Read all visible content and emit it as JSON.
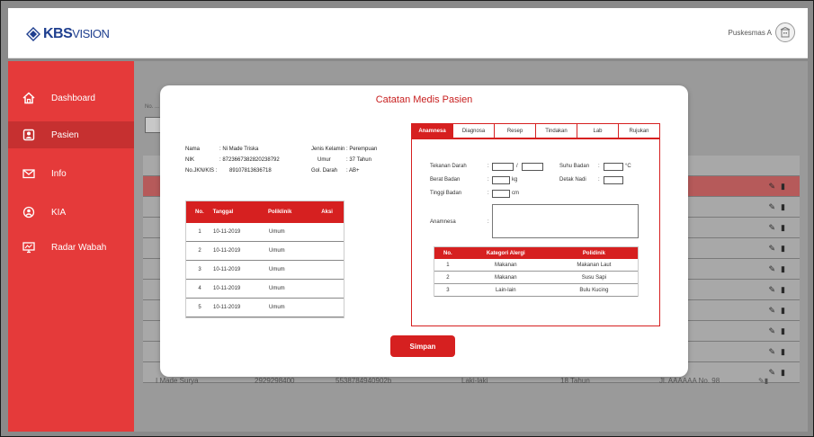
{
  "app": {
    "logo_main": "KBS",
    "logo_sub": "VISION",
    "user_name": "Puskesmas A"
  },
  "sidebar": {
    "items": [
      {
        "label": "Dashboard",
        "icon": "home-icon"
      },
      {
        "label": "Pasien",
        "icon": "patient-icon"
      },
      {
        "label": "Info",
        "icon": "mail-icon"
      },
      {
        "label": "KIA",
        "icon": "baby-icon"
      },
      {
        "label": "Radar Wabah",
        "icon": "monitor-icon"
      }
    ],
    "active_index": 1
  },
  "background": {
    "filter_label": "No. ...",
    "last_row": {
      "name": "I Made Surya",
      "phone": "2929298400",
      "id": "5538784940902b",
      "gender": "Laki-laki",
      "age": "18 Tahun",
      "address": "Jl. AAAAAA No. 98"
    }
  },
  "modal": {
    "title": "Catatan Medis Pasien",
    "patient": {
      "nama_label": "Nama",
      "nama_value": ": Ni Made Triska",
      "nik_label": "NIK",
      "nik_value": ":        8723667382820238792",
      "jkn_label": "No.JKN/KIS  :",
      "jkn_value": "89107813636718",
      "jk_label": "Jenis Kelamin",
      "jk_value": ": Perempuan",
      "umur_label": "Umur",
      "umur_value": ": 37 Tahun",
      "gol_label": "Gol. Darah",
      "gol_value": ": AB+"
    },
    "visits": {
      "headers": [
        "No.",
        "Tanggal",
        "Poliklinik",
        "Aksi"
      ],
      "rows": [
        [
          "1",
          "10-11-2019",
          "Umum"
        ],
        [
          "2",
          "10-11-2019",
          "Umum"
        ],
        [
          "3",
          "10-11-2019",
          "Umum"
        ],
        [
          "4",
          "10-11-2019",
          "Umum"
        ],
        [
          "5",
          "10-11-2019",
          "Umum"
        ]
      ]
    },
    "tabs": [
      "Anamnesa",
      "Diagnosa",
      "Resep",
      "Tindakan",
      "Lab",
      "Rujukan"
    ],
    "active_tab": 0,
    "form": {
      "tekanan_label": "Tekanan Darah",
      "sep_colon": ":",
      "slash": "/",
      "suhu_label": "Suhu Badan",
      "suhu_unit": "°C",
      "berat_label": "Berat Badan",
      "berat_unit": "kg",
      "nadi_label": "Detak Nadi",
      "tinggi_label": "Tinggi Badan",
      "tinggi_unit": "cm",
      "anamnesa_label": "Anamnesa"
    },
    "allergy": {
      "headers": [
        "No.",
        "Kategori Alergi",
        "Polidinik"
      ],
      "rows": [
        [
          "1",
          "Makanan",
          "Makanan Laut"
        ],
        [
          "2",
          "Makanan",
          "Susu Sapi"
        ],
        [
          "3",
          "Lain-lain",
          "Bulu Kucing"
        ]
      ]
    },
    "save_label": "Simpan"
  }
}
